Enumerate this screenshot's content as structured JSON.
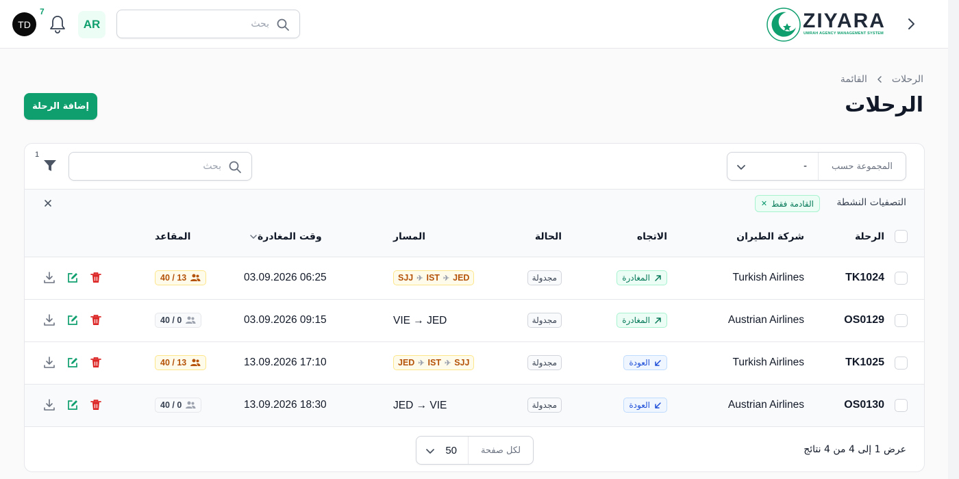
{
  "header": {
    "logo_text": "ZIYARA",
    "logo_subtitle": "UMRAH AGENCY MANAGEMENT SYSTEM",
    "search_placeholder": "بحث",
    "language": "AR",
    "notification_count": "7",
    "avatar_initials": "TD"
  },
  "page": {
    "breadcrumb": [
      "الرحلات",
      "القائمة"
    ],
    "title": "الرحلات",
    "add_button": "إضافة الرحلة"
  },
  "toolbar": {
    "group_by_label": "المجموعة حسب",
    "group_by_value": "-",
    "search_placeholder": "بحث",
    "filter_count": "1"
  },
  "active_filters": {
    "label": "التصفيات النشطة",
    "chips": [
      "القادمة فقط"
    ]
  },
  "table": {
    "columns": {
      "flight": "الرحلة",
      "airline": "شركة الطيران",
      "direction": "الاتجاه",
      "status": "الحالة",
      "route": "المسار",
      "departure": "وقت المغادرة",
      "seats": "المقاعد"
    },
    "rows": [
      {
        "flight": "TK1024",
        "airline": "Turkish Airlines",
        "direction": "المغادرة",
        "status": "مجدولة",
        "route": [
          "SJJ",
          "IST",
          "JED"
        ],
        "departure": "06:25 03.09.2026",
        "seats": "40 / 13"
      },
      {
        "flight": "OS0129",
        "airline": "Austrian Airlines",
        "direction": "المغادرة",
        "status": "مجدولة",
        "route_text": "VIE → JED",
        "departure": "09:15 03.09.2026",
        "seats": "40 / 0"
      },
      {
        "flight": "TK1025",
        "airline": "Turkish Airlines",
        "direction": "العودة",
        "status": "مجدولة",
        "route": [
          "JED",
          "IST",
          "SJJ"
        ],
        "departure": "17:10 13.09.2026",
        "seats": "40 / 13"
      },
      {
        "flight": "OS0130",
        "airline": "Austrian Airlines",
        "direction": "العودة",
        "status": "مجدولة",
        "route_text": "JED → VIE",
        "departure": "18:30 13.09.2026",
        "seats": "40 / 0"
      }
    ]
  },
  "footer": {
    "results_text": "عرض 1 إلى 4 من 4 نتائج",
    "per_page_label": "لكل صفحة",
    "per_page_value": "50"
  },
  "icons": {
    "back": "chevron-right-icon",
    "search": "search-icon",
    "notifications": "bell-icon",
    "filter": "funnel-icon",
    "outbound": "arrow-up-right-icon",
    "return": "arrow-down-left-icon",
    "plane": "plane-icon",
    "seats": "users-icon",
    "download": "download-icon",
    "edit": "edit-icon",
    "delete": "trash-icon"
  },
  "colors": {
    "primary": "#0f9f6e",
    "danger": "#dc2626",
    "outbound_bg": "#ecfdf5",
    "return_bg": "#eff6ff",
    "warning": "#b45309"
  }
}
